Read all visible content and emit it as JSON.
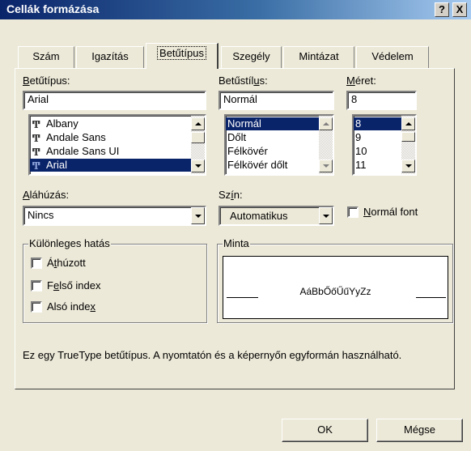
{
  "window": {
    "title": "Cellák formázása",
    "help_button": "?",
    "close_button": "X"
  },
  "tabs": [
    {
      "label": "Szám"
    },
    {
      "label": "Igazítás"
    },
    {
      "label": "Betűtípus"
    },
    {
      "label": "Szegély"
    },
    {
      "label": "Mintázat"
    },
    {
      "label": "Védelem"
    }
  ],
  "active_tab": "Betűtípus",
  "font": {
    "label": "Betűtípus:",
    "value": "Arial",
    "list": [
      {
        "name": "Albany",
        "icon": "truetype-icon"
      },
      {
        "name": "Andale Sans",
        "icon": "truetype-icon"
      },
      {
        "name": "Andale Sans UI",
        "icon": "truetype-icon"
      },
      {
        "name": "Arial",
        "icon": "truetype-icon",
        "selected": true
      }
    ]
  },
  "style": {
    "label": "Betűstílus:",
    "value": "Normál",
    "list": [
      "Normál",
      "Dőlt",
      "Félkövér",
      "Félkövér dőlt"
    ],
    "selected": "Normál"
  },
  "size": {
    "label": "Méret:",
    "value": "8",
    "list": [
      "8",
      "9",
      "10",
      "11"
    ],
    "selected": "8"
  },
  "underline": {
    "label": "Aláhúzás:",
    "value": "Nincs"
  },
  "color": {
    "label": "Szín:",
    "value": "Automatikus"
  },
  "normal_font": {
    "label": "Normál font",
    "checked": false
  },
  "effects": {
    "label": "Különleges hatás",
    "items": [
      {
        "label": "Áthúzott",
        "checked": false
      },
      {
        "label": "Felső index",
        "checked": false
      },
      {
        "label": "Alsó index",
        "checked": false
      }
    ]
  },
  "preview": {
    "label": "Minta",
    "sample": "AáBbŐőŰűYyZz"
  },
  "info_text": "Ez egy TrueType betűtípus.  A nyomtatón és a képernyőn egyformán használható.",
  "buttons": {
    "ok": "OK",
    "cancel": "Mégse"
  },
  "colors": {
    "titlebar_start": "#0a246a",
    "selection": "#0a246a",
    "dialog_bg": "#ece9d8"
  }
}
